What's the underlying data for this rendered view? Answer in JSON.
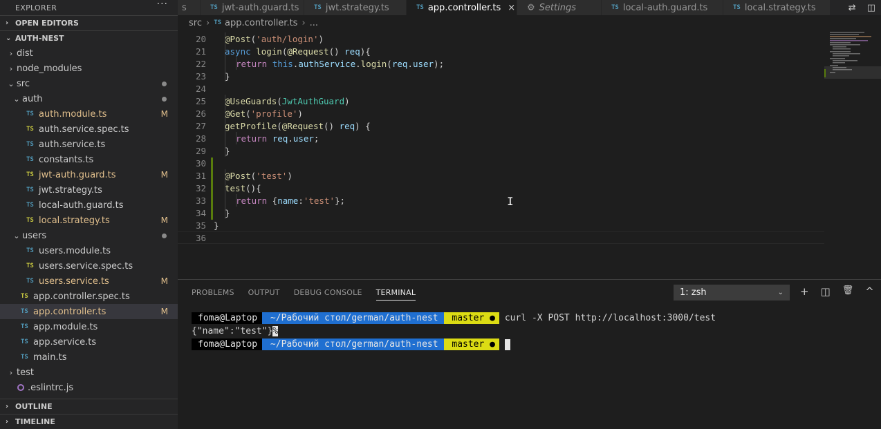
{
  "sidebar": {
    "title": "EXPLORER",
    "more": "···",
    "open_editors": "OPEN EDITORS",
    "project": "AUTH-NEST",
    "outline": "OUTLINE",
    "timeline": "TIMELINE",
    "tree": [
      {
        "label": "dist",
        "icon": "chevron-right",
        "status": ""
      },
      {
        "label": "node_modules",
        "icon": "chevron-right",
        "status": ""
      },
      {
        "label": "src",
        "icon": "chevron-down",
        "status": "dot"
      },
      {
        "label": "auth",
        "icon": "chevron-down",
        "status": "dot"
      },
      {
        "label": "auth.module.ts",
        "icon": "TS",
        "status": "M"
      },
      {
        "label": "auth.service.spec.ts",
        "icon": "TS",
        "status": ""
      },
      {
        "label": "auth.service.ts",
        "icon": "TS",
        "status": ""
      },
      {
        "label": "constants.ts",
        "icon": "TS",
        "status": ""
      },
      {
        "label": "jwt-auth.guard.ts",
        "icon": "TS",
        "status": "M"
      },
      {
        "label": "jwt.strategy.ts",
        "icon": "TS",
        "status": ""
      },
      {
        "label": "local-auth.guard.ts",
        "icon": "TS",
        "status": ""
      },
      {
        "label": "local.strategy.ts",
        "icon": "TS",
        "status": "M"
      },
      {
        "label": "users",
        "icon": "chevron-down",
        "status": "dot"
      },
      {
        "label": "users.module.ts",
        "icon": "TS",
        "status": ""
      },
      {
        "label": "users.service.spec.ts",
        "icon": "TS",
        "status": ""
      },
      {
        "label": "users.service.ts",
        "icon": "TS",
        "status": "M"
      },
      {
        "label": "app.controller.spec.ts",
        "icon": "TS",
        "status": ""
      },
      {
        "label": "app.controller.ts",
        "icon": "TS",
        "status": "M"
      },
      {
        "label": "app.module.ts",
        "icon": "TS",
        "status": ""
      },
      {
        "label": "app.service.ts",
        "icon": "TS",
        "status": ""
      },
      {
        "label": "main.ts",
        "icon": "TS",
        "status": ""
      },
      {
        "label": "test",
        "icon": "chevron-right",
        "status": ""
      },
      {
        "label": ".eslintrc.js",
        "icon": "eslint",
        "status": ""
      }
    ]
  },
  "tabs": [
    {
      "label": "s",
      "icon": ""
    },
    {
      "label": "jwt-auth.guard.ts",
      "icon": "TS"
    },
    {
      "label": "jwt.strategy.ts",
      "icon": "TS"
    },
    {
      "label": "app.controller.ts",
      "icon": "TS",
      "active": true
    },
    {
      "label": "Settings",
      "icon": "gear"
    },
    {
      "label": "local-auth.guard.ts",
      "icon": "TS"
    },
    {
      "label": "local.strategy.ts",
      "icon": "TS"
    }
  ],
  "close_glyph": "×",
  "ts_label": "TS",
  "breadcrumb": {
    "folder": "src",
    "file": "app.controller.ts",
    "tail": "..."
  },
  "editor": {
    "lines": [
      {
        "n": "20",
        "tokens": [
          [
            "dec",
            "@Post"
          ],
          [
            "",
            "("
          ],
          [
            "str",
            "'auth/login'"
          ],
          [
            "",
            ")"
          ]
        ]
      },
      {
        "n": "21",
        "tokens": [
          [
            "kw",
            "async"
          ],
          [
            "",
            " "
          ],
          [
            "fn",
            "login"
          ],
          [
            "",
            "("
          ],
          [
            "dec",
            "@Request"
          ],
          [
            "",
            "() "
          ],
          [
            "prop",
            "req"
          ],
          [
            "",
            "){"
          ]
        ]
      },
      {
        "n": "22",
        "tokens": [
          [
            "",
            ""
          ],
          [
            "kw2",
            "return"
          ],
          [
            "",
            " "
          ],
          [
            "kw",
            "this"
          ],
          [
            "",
            "."
          ],
          [
            "prop",
            "authService"
          ],
          [
            "",
            "."
          ],
          [
            "fn",
            "login"
          ],
          [
            "",
            "("
          ],
          [
            "prop",
            "req"
          ],
          [
            "",
            "."
          ],
          [
            "prop",
            "user"
          ],
          [
            "",
            ");"
          ]
        ]
      },
      {
        "n": "23",
        "tokens": [
          [
            "",
            "}"
          ]
        ]
      },
      {
        "n": "24",
        "tokens": []
      },
      {
        "n": "25",
        "tokens": [
          [
            "dec",
            "@UseGuards"
          ],
          [
            "",
            "("
          ],
          [
            "cls",
            "JwtAuthGuard"
          ],
          [
            "",
            ")"
          ]
        ]
      },
      {
        "n": "26",
        "tokens": [
          [
            "dec",
            "@Get"
          ],
          [
            "",
            "("
          ],
          [
            "str",
            "'profile'"
          ],
          [
            "",
            ")"
          ]
        ]
      },
      {
        "n": "27",
        "tokens": [
          [
            "fn",
            "getProfile"
          ],
          [
            "",
            "("
          ],
          [
            "dec",
            "@Request"
          ],
          [
            "",
            "() "
          ],
          [
            "prop",
            "req"
          ],
          [
            "",
            ") {"
          ]
        ]
      },
      {
        "n": "28",
        "tokens": [
          [
            "kw2",
            "return"
          ],
          [
            "",
            " "
          ],
          [
            "prop",
            "req"
          ],
          [
            "",
            "."
          ],
          [
            "prop",
            "user"
          ],
          [
            "",
            ";"
          ]
        ]
      },
      {
        "n": "29",
        "tokens": [
          [
            "",
            "}"
          ]
        ]
      },
      {
        "n": "30",
        "tokens": []
      },
      {
        "n": "31",
        "tokens": [
          [
            "dec",
            "@Post"
          ],
          [
            "",
            "("
          ],
          [
            "str",
            "'test'"
          ],
          [
            "",
            ")"
          ]
        ]
      },
      {
        "n": "32",
        "tokens": [
          [
            "fn",
            "test"
          ],
          [
            "",
            "(){"
          ]
        ]
      },
      {
        "n": "33",
        "tokens": [
          [
            "kw2",
            "return"
          ],
          [
            "",
            " {"
          ],
          [
            "prop",
            "name"
          ],
          [
            "",
            ":"
          ],
          [
            "str",
            "'test'"
          ],
          [
            "",
            "};"
          ]
        ]
      },
      {
        "n": "34",
        "tokens": [
          [
            "",
            "}"
          ]
        ]
      },
      {
        "n": "35",
        "tokens": [
          [
            "",
            "}"
          ]
        ]
      },
      {
        "n": "36",
        "tokens": []
      }
    ]
  },
  "panel": {
    "tabs": [
      "PROBLEMS",
      "OUTPUT",
      "DEBUG CONSOLE",
      "TERMINAL"
    ],
    "active_tab": "TERMINAL",
    "terminal_select": "1: zsh",
    "actions": {
      "add": "+",
      "split": "◫",
      "trash": "🗑",
      "maximize": "^",
      "close": "×"
    }
  },
  "terminal": {
    "user": "foma@Laptop",
    "path": " ~/Рабочий стол/german/auth-nest",
    "git": " master ●",
    "command": " curl -X POST http://localhost:3000/test",
    "output": "{\"name\":\"test\"}",
    "percent": "%",
    "glyph": "",
    "branch_glyph": ""
  },
  "colors": {
    "accent": "#007acc",
    "path_bg": "#1f6fd1",
    "git_bg": "#dcdc14",
    "modified": "#e2c08d",
    "gutter_added": "#587c0c"
  }
}
